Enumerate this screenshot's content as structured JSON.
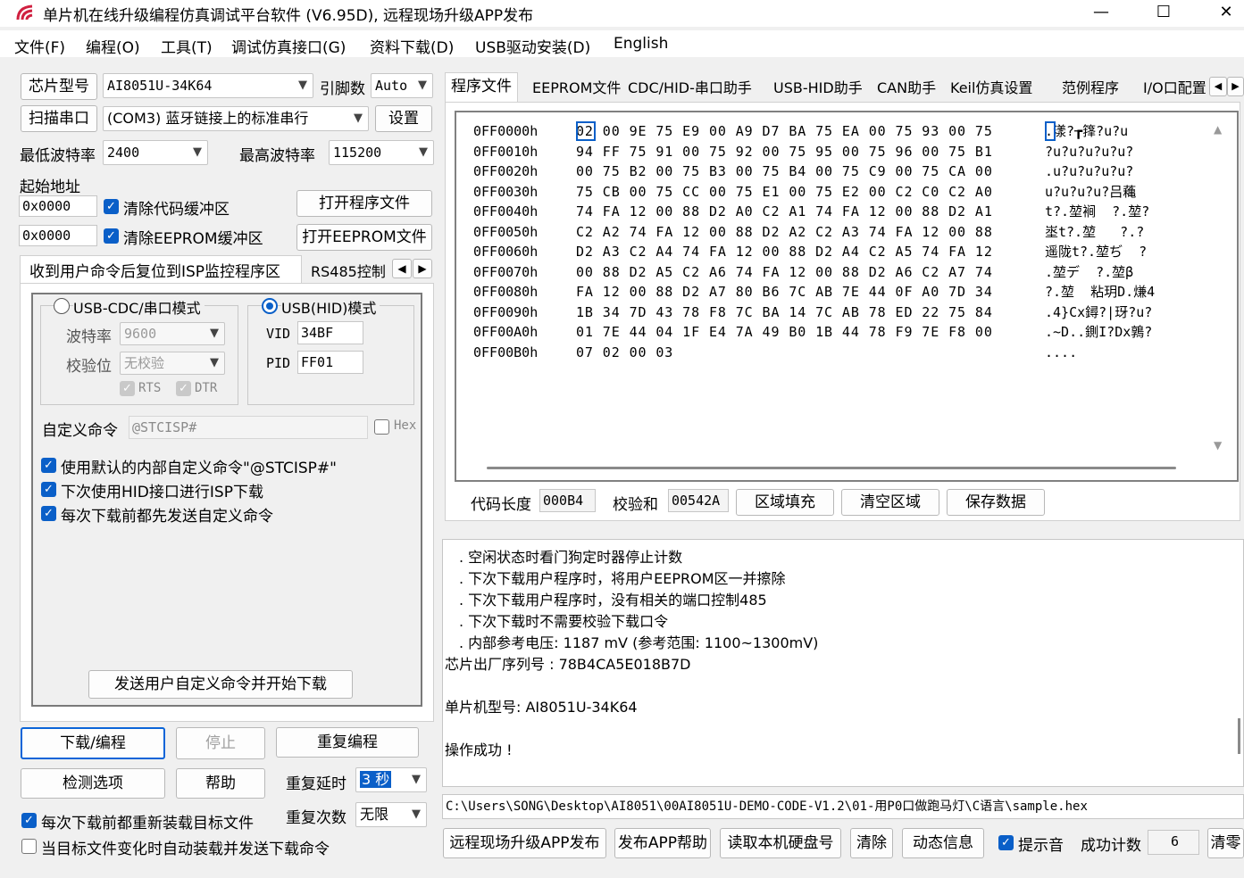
{
  "window": {
    "title": "单片机在线升级编程仿真调试平台软件 (V6.95D), 远程现场升级APP发布",
    "minimize": "—",
    "maximize": "☐",
    "close": "✕"
  },
  "menu": [
    "文件(F)",
    "编程(O)",
    "工具(T)",
    "调试仿真接口(G)",
    "资料下载(D)",
    "USB驱动安装(D)",
    "English"
  ],
  "left": {
    "chip_model_btn": "芯片型号",
    "chip_model": "AI8051U-34K64",
    "pins_label": "引脚数",
    "pins": "Auto",
    "scan_btn": "扫描串口",
    "port": "(COM3) 蓝牙链接上的标准串行",
    "settings_btn": "设置",
    "min_baud_label": "最低波特率",
    "min_baud": "2400",
    "max_baud_label": "最高波特率",
    "max_baud": "115200",
    "start_addr_label": "起始地址",
    "addr1": "0x0000",
    "clear_code": "清除代码缓冲区",
    "open_prog_btn": "打开程序文件",
    "addr2": "0x0000",
    "clear_eeprom": "清除EEPROM缓冲区",
    "open_eeprom_btn": "打开EEPROM文件",
    "tab_isp": "收到用户命令后复位到ISP监控程序区",
    "tab_rs485": "RS485控制",
    "mode_cdc": "USB-CDC/串口模式",
    "mode_hid": "USB(HID)模式",
    "baud_label": "波特率",
    "baud": "9600",
    "parity_label": "校验位",
    "parity": "无校验",
    "rts": "RTS",
    "dtr": "DTR",
    "vid_label": "VID",
    "vid": "34BF",
    "pid_label": "PID",
    "pid": "FF01",
    "custom_cmd_label": "自定义命令",
    "custom_cmd": "@STCISP#",
    "hex_label": "Hex",
    "opt1": "使用默认的内部自定义命令\"@STCISP#\"",
    "opt2": "下次使用HID接口进行ISP下载",
    "opt3": "每次下载前都先发送自定义命令",
    "send_btn": "发送用户自定义命令并开始下载",
    "download_btn": "下载/编程",
    "stop_btn": "停止",
    "reprog_btn": "重复编程",
    "check_btn": "检测选项",
    "help_btn": "帮助",
    "repeat_delay_label": "重复延时",
    "repeat_delay": "3 秒",
    "repeat_count_label": "重复次数",
    "repeat_count": "无限",
    "reload_label": "每次下载前都重新装载目标文件",
    "autoload_label": "当目标文件变化时自动装载并发送下载命令"
  },
  "tabs": [
    "程序文件",
    "EEPROM文件",
    "CDC/HID-串口助手",
    "USB-HID助手",
    "CAN助手",
    "Keil仿真设置",
    "范例程序",
    "I/O口配置"
  ],
  "hex": {
    "addresses": [
      "0FF0000h",
      "0FF0010h",
      "0FF0020h",
      "0FF0030h",
      "0FF0040h",
      "0FF0050h",
      "0FF0060h",
      "0FF0070h",
      "0FF0080h",
      "0FF0090h",
      "0FF00A0h",
      "0FF00B0h"
    ],
    "bytes": [
      "02 00 9E 75 E9 00 A9 D7 BA 75 EA 00 75 93 00 75",
      "94 FF 75 91 00 75 92 00 75 95 00 75 96 00 75 B1",
      "00 75 B2 00 75 B3 00 75 B4 00 75 C9 00 75 CA 00",
      "75 CB 00 75 CC 00 75 E1 00 75 E2 00 C2 C0 C2 A0",
      "74 FA 12 00 88 D2 A0 C2 A1 74 FA 12 00 88 D2 A1",
      "C2 A2 74 FA 12 00 88 D2 A2 C2 A3 74 FA 12 00 88",
      "D2 A3 C2 A4 74 FA 12 00 88 D2 A4 C2 A5 74 FA 12",
      "00 88 D2 A5 C2 A6 74 FA 12 00 88 D2 A6 C2 A7 74",
      "FA 12 00 88 D2 A7 80 B6 7C AB 7E 44 0F A0 7D 34",
      "1B 34 7D 43 78 F8 7C BA 14 7C AB 78 ED 22 75 84",
      "01 7E 44 04 1F E4 7A 49 B0 1B 44 78 F9 7E F8 00",
      "07 02 00 03"
    ],
    "ascii": [
      ".漾?┲箨?u?u",
      "?u?u?u?u?u?",
      ".u?u?u?u?u?",
      "u?u?u?u?吕蘒",
      "t?.堃裥  ?.堃?",
      "埊t?.堃   ?.?",
      "遥陇t?.堃ぢ  ?",
      ".堃デ  ?.堃β",
      "?.堃  粘玥D.熑4",
      ".4}Cx鐞?|玡?u?",
      ".~D..鍘I?Dx鶉?",
      "...."
    ]
  },
  "code_len_label": "代码长度",
  "code_len": "000B4",
  "checksum_label": "校验和",
  "checksum": "00542A",
  "fill_btn": "区域填充",
  "clear_area_btn": "清空区域",
  "save_btn": "保存数据",
  "log": [
    ". 空闲状态时看门狗定时器停止计数",
    ". 下次下载用户程序时，将用户EEPROM区一并擦除",
    ". 下次下载用户程序时，没有相关的端口控制485",
    ". 下次下载时不需要校验下载口令",
    ". 内部参考电压: 1187 mV (参考范围: 1100~1300mV)",
    "芯片出厂序列号 : 78B4CA5E018B7D",
    "",
    " 单片机型号: AI8051U-34K64",
    "",
    "操作成功 !"
  ],
  "path": "C:\\Users\\SONG\\Desktop\\AI8051\\00AI8051U-DEMO-CODE-V1.2\\01-用P0口做跑马灯\\C语言\\sample.hex",
  "bottom": {
    "publish_btn": "远程现场升级APP发布",
    "publish_help_btn": "发布APP帮助",
    "read_disk_btn": "读取本机硬盘号",
    "clear_btn": "清除",
    "dynamic_btn": "动态信息",
    "beep_label": "提示音",
    "success_label": "成功计数",
    "success_count": "6",
    "clear_zero_btn": "清零"
  },
  "colors": {
    "accent": "#0a5fc8",
    "bg": "#f0f0f0"
  }
}
